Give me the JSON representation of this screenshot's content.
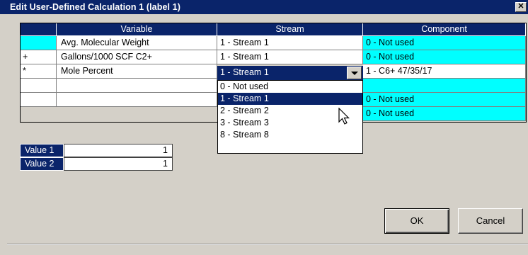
{
  "window": {
    "title": "Edit User-Defined Calculation 1 (label 1)",
    "close_glyph": "✕"
  },
  "grid": {
    "headers": [
      "",
      "Variable",
      "Stream",
      "Component"
    ],
    "rows": [
      {
        "op": "",
        "variable": "Avg. Molecular Weight",
        "stream": "1 - Stream 1",
        "component": "0 - Not used"
      },
      {
        "op": "+",
        "variable": "Gallons/1000 SCF C2+",
        "stream": "1 - Stream 1",
        "component": "0 - Not used"
      },
      {
        "op": "*",
        "variable": "Mole Percent",
        "stream": "1 - Stream 1",
        "component": "1 - C6+ 47/35/17"
      },
      {
        "op": "",
        "variable": "",
        "stream": "",
        "component": "0 - Not used"
      },
      {
        "op": "",
        "variable": "",
        "stream": "",
        "component": "0 - Not used"
      }
    ]
  },
  "dropdown": {
    "selected": "1 - Stream 1",
    "options": [
      "0 - Not used",
      "1 - Stream 1",
      "2 - Stream 2",
      "3 - Stream 3",
      "8 - Stream 8"
    ]
  },
  "values": [
    {
      "label": "Value 1",
      "value": "1"
    },
    {
      "label": "Value 2",
      "value": "1"
    }
  ],
  "buttons": {
    "ok": "OK",
    "cancel": "Cancel"
  },
  "colors": {
    "selection": "#0a246a",
    "cyan": "#00ffff",
    "face": "#d4d0c8"
  }
}
